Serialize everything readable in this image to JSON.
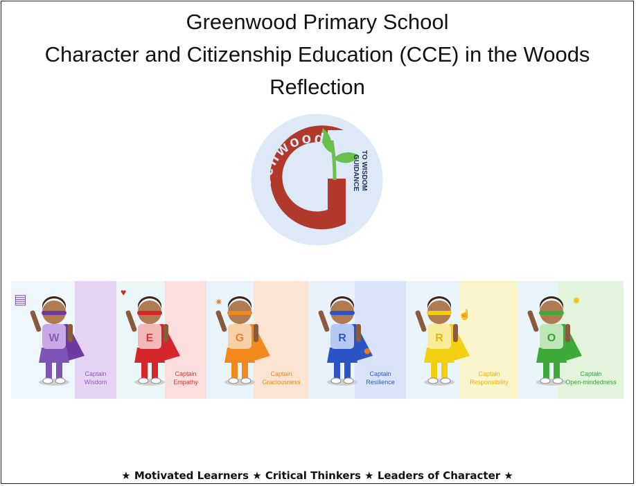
{
  "header": {
    "school_name": "Greenwood Primary School",
    "program_title": "Character and Citizenship Education (CCE) in the Woods",
    "subtitle": "Reflection"
  },
  "logo": {
    "brand_text": "Greenwood",
    "tagline_line1": "GUIDANCE",
    "tagline_line2": "TO WISDOM",
    "ring_color": "#dde9f6",
    "letter_color": "#b0392b",
    "sprout_color": "#6bbf4e"
  },
  "heroes": [
    {
      "letter": "W",
      "caption_line1": "Captain",
      "caption_line2": "Wisdom",
      "icon": "book-icon",
      "left_bg": "#eef7fb",
      "right_bg": "#e6d3f3",
      "text_color": "#8a5db5",
      "shirt": "#c8a9e6",
      "bottom": "#7d53b5",
      "cape": "#6d3aa0",
      "mask": "#6d3aa0"
    },
    {
      "letter": "E",
      "caption_line1": "Captain",
      "caption_line2": "Empathy",
      "icon": "heart-icon",
      "left_bg": "#eaf6f7",
      "right_bg": "#fbdede",
      "text_color": "#d3393b",
      "shirt": "#f5b8b8",
      "bottom": "#d6262b",
      "cape": "#d6262b",
      "mask": "#d6262b"
    },
    {
      "letter": "G",
      "caption_line1": "Captain",
      "caption_line2": "Graciousness",
      "icon": "sparkle-icon",
      "left_bg": "#eaf4fb",
      "right_bg": "#fbe5d2",
      "text_color": "#e58a2c",
      "shirt": "#f8d0a8",
      "bottom": "#f08a1c",
      "cape": "#f08a1c",
      "mask": "#f08a1c"
    },
    {
      "letter": "R",
      "caption_line1": "Captain",
      "caption_line2": "Resilience",
      "icon": "basketball-icon",
      "left_bg": "#e9f2fb",
      "right_bg": "#d9e4fa",
      "text_color": "#3458b8",
      "shirt": "#b6c9f3",
      "bottom": "#2c54c7",
      "cape": "#2c54c7",
      "mask": "#2c54c7"
    },
    {
      "letter": "R",
      "caption_line1": "Captain",
      "caption_line2": "Responsibility",
      "icon": "thumbs-up-icon",
      "left_bg": "#eaf5fb",
      "right_bg": "#fbf5cc",
      "text_color": "#e2b313",
      "shirt": "#f8ec9a",
      "bottom": "#f2cf10",
      "cape": "#f2cf10",
      "mask": "#f2cf10"
    },
    {
      "letter": "O",
      "caption_line1": "Captain",
      "caption_line2": "Open-mindedness",
      "icon": "lightbulb-icon",
      "left_bg": "#eaf5fa",
      "right_bg": "#e2f4dc",
      "text_color": "#3b9a3f",
      "shirt": "#bfe6b8",
      "bottom": "#3faa3a",
      "cape": "#3faa3a",
      "mask": "#3faa3a"
    }
  ],
  "footer": {
    "motto": "★ Motivated Learners ★ Critical Thinkers ★ Leaders of Character ★"
  }
}
